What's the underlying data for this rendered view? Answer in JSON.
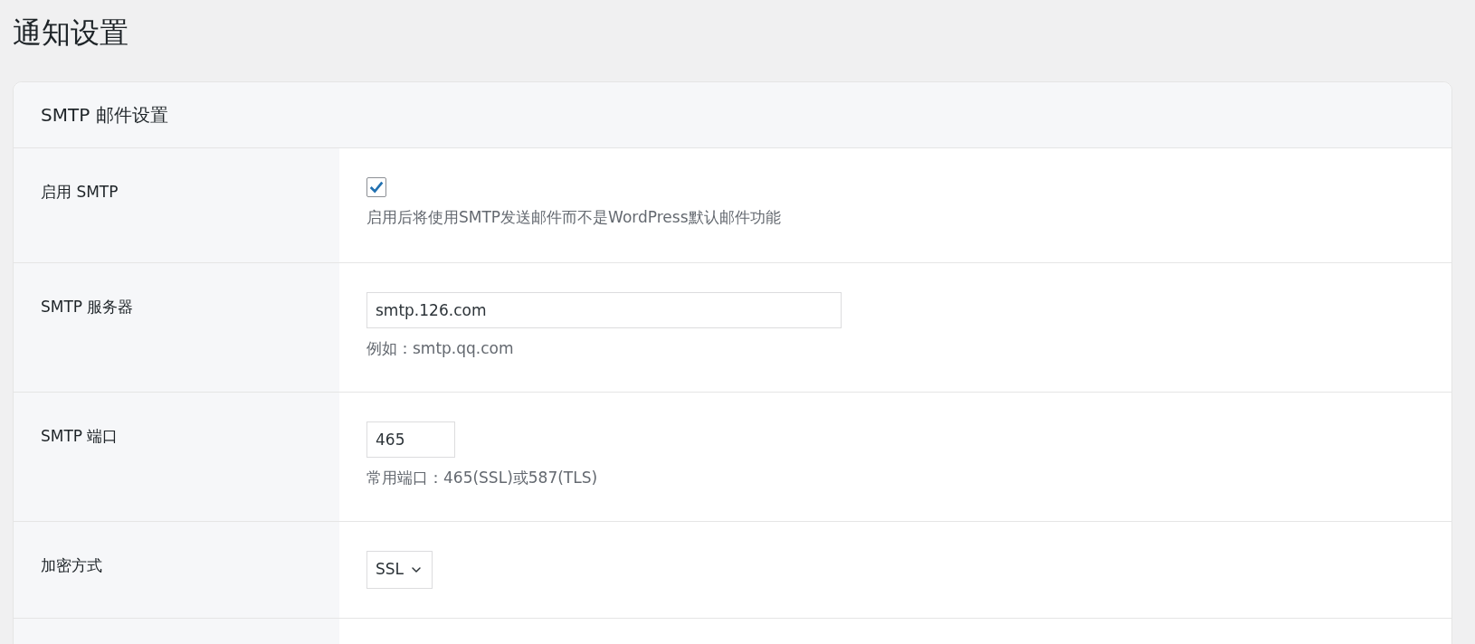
{
  "page_title": "通知设置",
  "section": {
    "title": "SMTP 邮件设置",
    "fields": [
      {
        "kind": "checkbox",
        "label": "启用 SMTP",
        "checked": true,
        "help": "启用后将使用SMTP发送邮件而不是WordPress默认邮件功能"
      },
      {
        "kind": "text",
        "label": "SMTP 服务器",
        "value": "smtp.126.com",
        "help": "例如：smtp.qq.com"
      },
      {
        "kind": "number",
        "label": "SMTP 端口",
        "value": "465",
        "help": "常用端口：465(SSL)或587(TLS)"
      },
      {
        "kind": "select",
        "label": "加密方式",
        "value": "SSL"
      }
    ]
  }
}
